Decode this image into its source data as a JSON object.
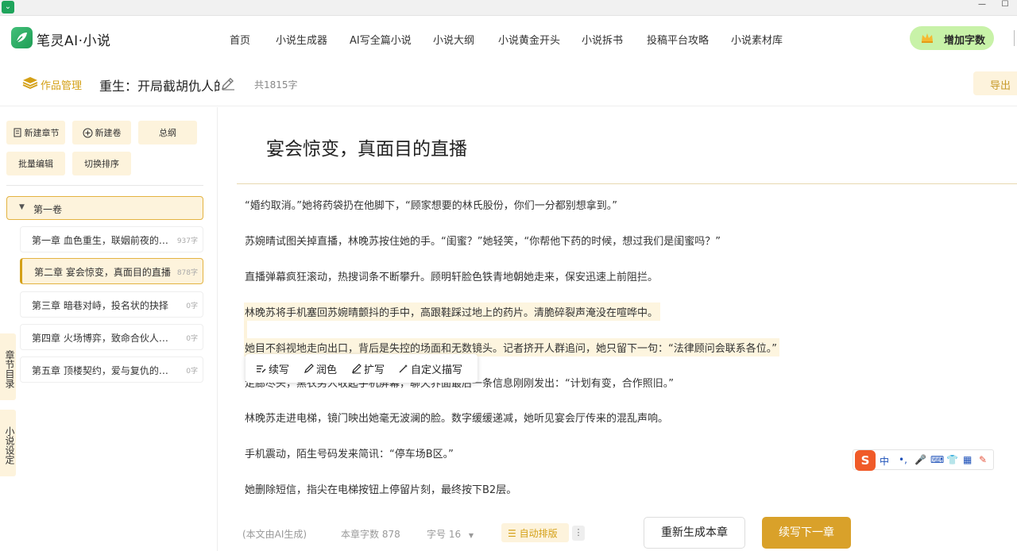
{
  "browser": {
    "minimize": "—",
    "maximize": "☐"
  },
  "brand": {
    "name": "笔灵AI·小说"
  },
  "nav": [
    "首页",
    "小说生成器",
    "AI写全篇小说",
    "小说大纲",
    "小说黄金开头",
    "小说拆书",
    "投稿平台攻略",
    "小说素材库"
  ],
  "add_words_label": "增加字数",
  "workbar": {
    "management": "作品管理",
    "title": "重生：开局截胡仇人的",
    "word_count": "共1815字",
    "export": "导出"
  },
  "sidebar": {
    "buttons": {
      "new_chapter": "新建章节",
      "new_volume": "新建卷",
      "outline": "总纲",
      "batch_edit": "批量编辑",
      "switch_sort": "切换排序"
    },
    "volume": "第一卷",
    "chapters": [
      {
        "title": "第一章 血色重生，联姻前夜的背叛",
        "count": "937字"
      },
      {
        "title": "第二章 宴会惊变，真面目的直播",
        "count": "878字"
      },
      {
        "title": "第三章 暗巷对峙，投名状的抉择",
        "count": "0字"
      },
      {
        "title": "第四章 火场博弈，致命合伙人的底牌",
        "count": "0字"
      },
      {
        "title": "第五章 顶楼契约，爱与复仇的终局",
        "count": "0字"
      }
    ],
    "tabs": {
      "chapter_dir": "章节目录",
      "novel_settings": "小说设定"
    }
  },
  "editor": {
    "chapter_title": "宴会惊变，真面目的直播",
    "paragraphs": [
      "“婚约取消。”她将药袋扔在他脚下，“顾家想要的林氏股份，你们一分都别想拿到。”",
      "苏婉晴试图关掉直播，林晚苏按住她的手。“闺蜜？”她轻笑，“你帮他下药的时候，想过我们是闺蜜吗？”",
      "直播弹幕疯狂滚动，热搜词条不断攀升。顾明轩脸色铁青地朝她走来，保安迅速上前阻拦。",
      "林晚苏将手机塞回苏婉晴颤抖的手中，高跟鞋踩过地上的药片。清脆碎裂声淹没在喧哗中。",
      "她目不斜视地走向出口，背后是失控的场面和无数镜头。记者挤开人群追问，她只留下一句：“法律顾问会联系各位。”",
      "走廊尽头，黑衣男人收起手机屏幕，聊天界面最后一条信息刚刚发出：“计划有变，合作照旧。”",
      "林晚苏走进电梯，镜门映出她毫无波澜的脸。数字缓缓递减，她听见宴会厅传来的混乱声响。",
      "手机震动，陌生号码发来简讯：“停车场B区。”",
      "她删除短信，指尖在电梯按钮上停留片刻，最终按下B2层。"
    ],
    "ai_tools": {
      "continue": "续写",
      "polish": "润色",
      "expand": "扩写",
      "custom": "自定义描写"
    }
  },
  "ime": {
    "logo": "S",
    "lang": "中",
    "punct": "•,",
    "mic": "🎤",
    "kbd": "⌨",
    "skin": "👕",
    "apps": "▦",
    "tool": "✎"
  },
  "footer": {
    "ai_note": "(本文由AI生成)",
    "chapter_words": "本章字数 878",
    "font_size": "字号 16",
    "auto_format": "自动排版",
    "more": "⋮",
    "regenerate": "重新生成本章",
    "continue_next": "续写下一章"
  },
  "colors": {
    "accent": "#d9a12a",
    "accent_light": "#fdf3dc",
    "brand_green": "#1f9d55",
    "add_words_bg": "#c8f2a8"
  }
}
